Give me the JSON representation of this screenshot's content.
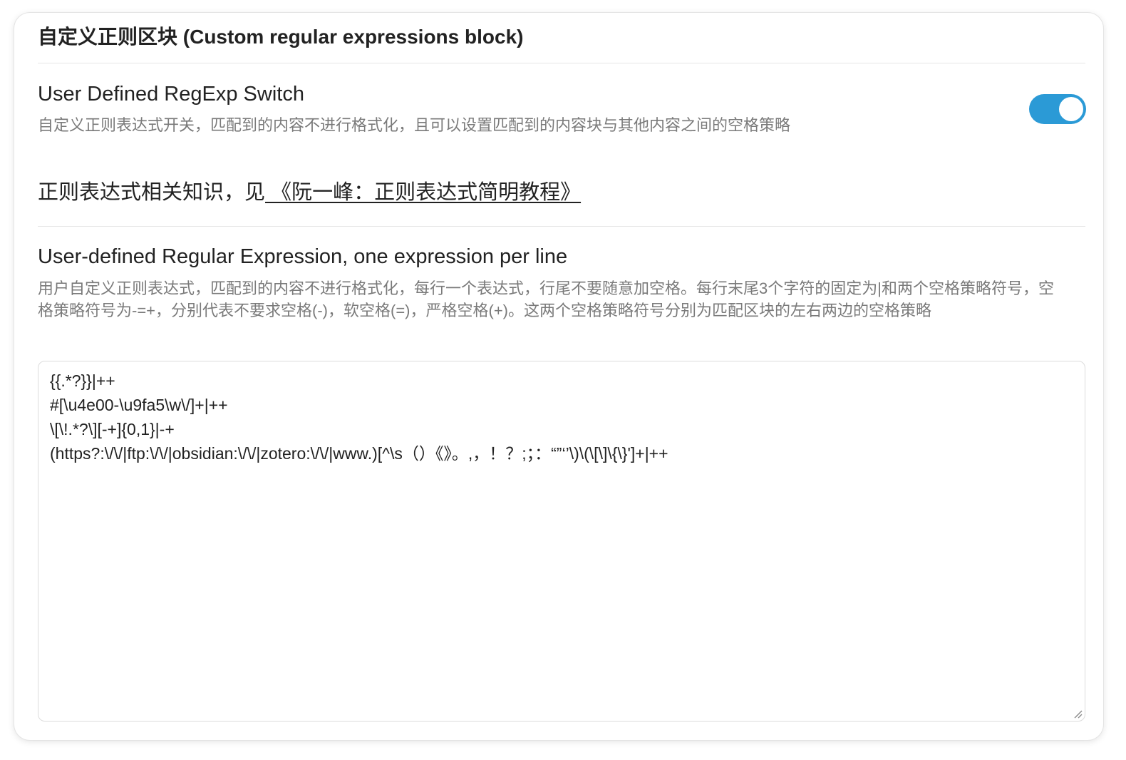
{
  "section": {
    "title": "自定义正则区块 (Custom regular expressions block)"
  },
  "regexp_switch": {
    "name": "User Defined RegExp Switch",
    "description": "自定义正则表达式开关，匹配到的内容不进行格式化，且可以设置匹配到的内容块与其他内容之间的空格策略",
    "enabled": true,
    "accent_color": "#2b9ad6"
  },
  "knowledge": {
    "prefix": "正则表达式相关知识，见",
    "link_text": " 《阮一峰：正则表达式简明教程》 "
  },
  "user_regex": {
    "name": "User-defined Regular Expression, one expression per line",
    "description": "用户自定义正则表达式，匹配到的内容不进行格式化，每行一个表达式，行尾不要随意加空格。每行末尾3个字符的固定为|和两个空格策略符号，空格策略符号为-=+，分别代表不要求空格(-)，软空格(=)，严格空格(+)。这两个空格策略符号分别为匹配区块的左右两边的空格策略",
    "lines": [
      "{{.*?}}|++",
      "#[\\u4e00-\\u9fa5\\w\\/]+|++",
      "\\[\\!.*?\\][-+]{0,1}|-+",
      "(https?:\\/\\/|ftp:\\/\\/|obsidian:\\/\\/|zotero:\\/\\/|www.)[^\\s（）《》。,，！？;；：“”‘’\\)\\(\\[\\]\\{\\}']+|++"
    ]
  }
}
